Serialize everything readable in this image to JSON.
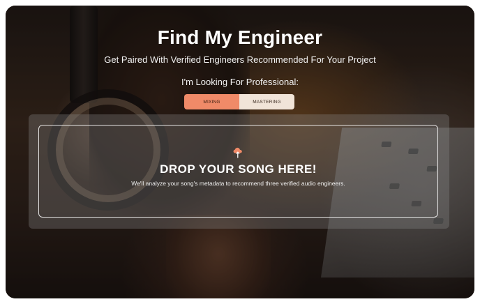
{
  "header": {
    "title": "Find My Engineer",
    "subtitle": "Get Paired With Verified Engineers Recommended For Your Project",
    "prompt": "I'm Looking For Professional:"
  },
  "toggle": {
    "options": [
      {
        "label": "MIXING",
        "active": true
      },
      {
        "label": "MASTERING",
        "active": false
      }
    ]
  },
  "dropzone": {
    "icon": "upload-cloud-icon",
    "title": "DROP YOUR SONG HERE!",
    "description": "We'll analyze your song's metadata to recommend three verified audio engineers."
  },
  "colors": {
    "accent": "#f08a68",
    "toggle_inactive": "#f1e4d8",
    "text": "#ffffff"
  }
}
